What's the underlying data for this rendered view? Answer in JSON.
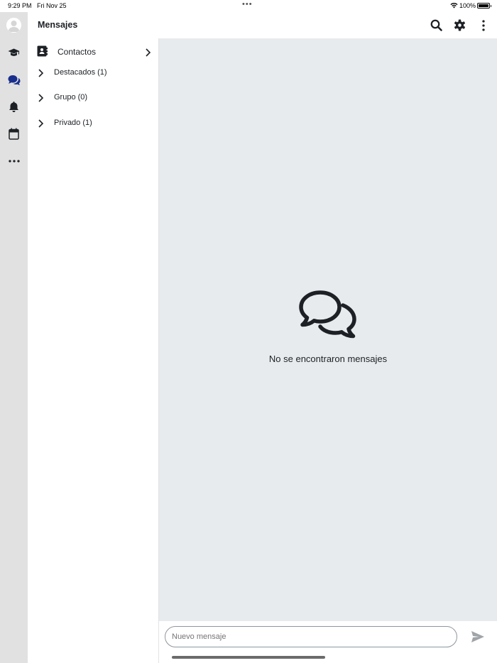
{
  "status_bar": {
    "time": "9:29 PM",
    "date": "Fri Nov 25",
    "multitask_dots": "•••",
    "battery_percent": "100%",
    "battery_level": 1.0
  },
  "rail": {
    "items": [
      {
        "name": "avatar"
      },
      {
        "name": "graduation-cap-icon"
      },
      {
        "name": "chat-bubbles-icon",
        "active": true
      },
      {
        "name": "bell-icon"
      },
      {
        "name": "calendar-icon"
      },
      {
        "name": "more-horizontal-icon"
      }
    ]
  },
  "header": {
    "title": "Mensajes",
    "icons": [
      "search-icon",
      "gear-icon",
      "more-vertical-icon"
    ]
  },
  "sidebar": {
    "contacts_label": "Contactos",
    "sections": [
      {
        "label": "Destacados (1)"
      },
      {
        "label": "Grupo (0)"
      },
      {
        "label": "Privado (1)"
      }
    ]
  },
  "main": {
    "empty_text": "No se encontraron mensajes",
    "empty_icon": "chat-bubbles-icon"
  },
  "composer": {
    "placeholder": "Nuevo mensaje",
    "value": ""
  },
  "colors": {
    "rail_bg": "#e1e1e1",
    "main_bg": "#e8ebee",
    "accent": "#1a2f8c",
    "text": "#1d2125"
  }
}
